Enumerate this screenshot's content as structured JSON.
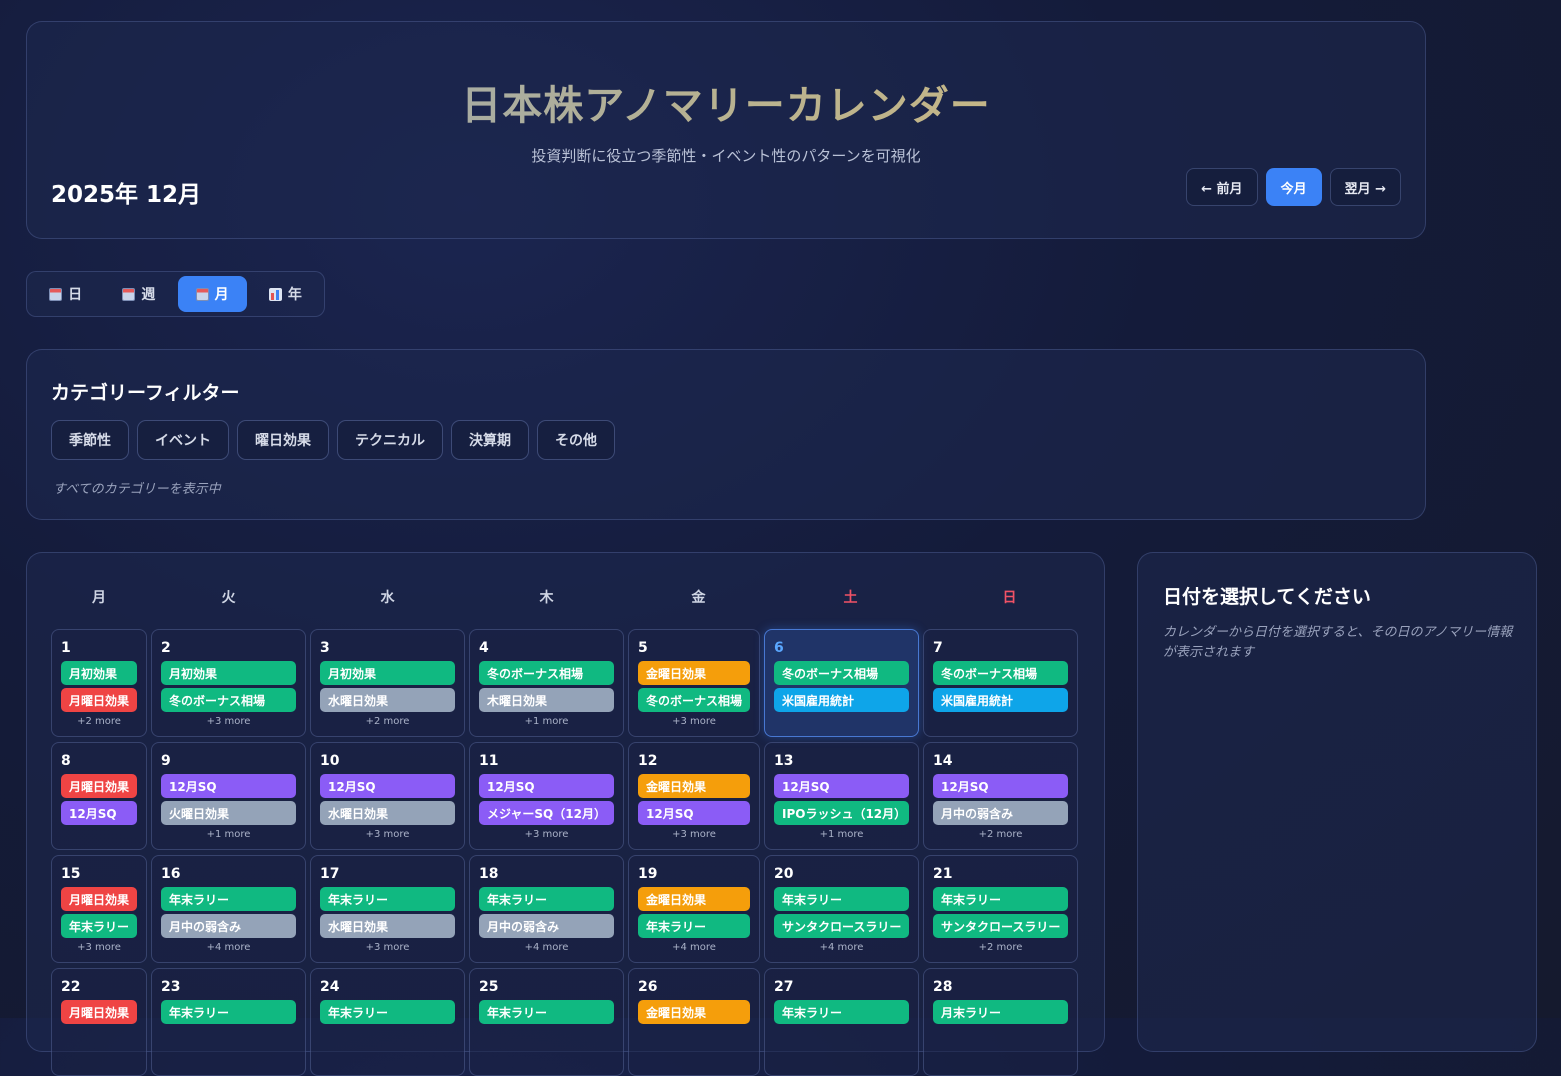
{
  "header": {
    "title": "日本株アノマリーカレンダー",
    "subtitle": "投資判断に役立つ季節性・イベント性のパターンを可視化",
    "month_label": "2025年 12月",
    "prev_label": "← 前月",
    "today_label": "今月",
    "next_label": "翌月 →"
  },
  "view_tabs": [
    {
      "label": "日",
      "icon": "calendar-icon"
    },
    {
      "label": "週",
      "icon": "calendar-icon"
    },
    {
      "label": "月",
      "icon": "calendar-icon",
      "active": true
    },
    {
      "label": "年",
      "icon": "bar-chart-icon"
    }
  ],
  "filter": {
    "title": "カテゴリーフィルター",
    "chips": [
      "季節性",
      "イベント",
      "曜日効果",
      "テクニカル",
      "決算期",
      "その他"
    ],
    "status": "すべてのカテゴリーを表示中"
  },
  "colors": {
    "green": "#10b981",
    "red": "#ef4444",
    "orange": "#f59e0b",
    "purple": "#8b5cf6",
    "gray": "#94a3b8",
    "blue": "#0ea5e9",
    "accent": "#3b82f6"
  },
  "calendar": {
    "weekdays": [
      "月",
      "火",
      "水",
      "木",
      "金",
      "土",
      "日"
    ],
    "days": [
      {
        "n": "1",
        "tags": [
          [
            "月初効果",
            "green"
          ],
          [
            "月曜日効果",
            "red"
          ]
        ],
        "more": "+2 more"
      },
      {
        "n": "2",
        "tags": [
          [
            "月初効果",
            "green"
          ],
          [
            "冬のボーナス相場",
            "green"
          ]
        ],
        "more": "+3 more"
      },
      {
        "n": "3",
        "tags": [
          [
            "月初効果",
            "green"
          ],
          [
            "水曜日効果",
            "gray"
          ]
        ],
        "more": "+2 more"
      },
      {
        "n": "4",
        "tags": [
          [
            "冬のボーナス相場",
            "green"
          ],
          [
            "木曜日効果",
            "gray"
          ]
        ],
        "more": "+1 more"
      },
      {
        "n": "5",
        "tags": [
          [
            "金曜日効果",
            "orange"
          ],
          [
            "冬のボーナス相場",
            "green"
          ]
        ],
        "more": "+3 more"
      },
      {
        "n": "6",
        "tags": [
          [
            "冬のボーナス相場",
            "green"
          ],
          [
            "米国雇用統計",
            "blue"
          ]
        ],
        "more": "",
        "today": true
      },
      {
        "n": "7",
        "tags": [
          [
            "冬のボーナス相場",
            "green"
          ],
          [
            "米国雇用統計",
            "blue"
          ]
        ],
        "more": ""
      },
      {
        "n": "8",
        "tags": [
          [
            "月曜日効果",
            "red"
          ],
          [
            "12月SQ",
            "purple"
          ]
        ],
        "more": ""
      },
      {
        "n": "9",
        "tags": [
          [
            "12月SQ",
            "purple"
          ],
          [
            "火曜日効果",
            "gray"
          ]
        ],
        "more": "+1 more"
      },
      {
        "n": "10",
        "tags": [
          [
            "12月SQ",
            "purple"
          ],
          [
            "水曜日効果",
            "gray"
          ]
        ],
        "more": "+3 more"
      },
      {
        "n": "11",
        "tags": [
          [
            "12月SQ",
            "purple"
          ],
          [
            "メジャーSQ（12月）",
            "purple"
          ]
        ],
        "more": "+3 more"
      },
      {
        "n": "12",
        "tags": [
          [
            "金曜日効果",
            "orange"
          ],
          [
            "12月SQ",
            "purple"
          ]
        ],
        "more": "+3 more"
      },
      {
        "n": "13",
        "tags": [
          [
            "12月SQ",
            "purple"
          ],
          [
            "IPOラッシュ（12月）",
            "green"
          ]
        ],
        "more": "+1 more"
      },
      {
        "n": "14",
        "tags": [
          [
            "12月SQ",
            "purple"
          ],
          [
            "月中の弱含み",
            "gray"
          ]
        ],
        "more": "+2 more"
      },
      {
        "n": "15",
        "tags": [
          [
            "月曜日効果",
            "red"
          ],
          [
            "年末ラリー",
            "green"
          ]
        ],
        "more": "+3 more"
      },
      {
        "n": "16",
        "tags": [
          [
            "年末ラリー",
            "green"
          ],
          [
            "月中の弱含み",
            "gray"
          ]
        ],
        "more": "+4 more"
      },
      {
        "n": "17",
        "tags": [
          [
            "年末ラリー",
            "green"
          ],
          [
            "水曜日効果",
            "gray"
          ]
        ],
        "more": "+3 more"
      },
      {
        "n": "18",
        "tags": [
          [
            "年末ラリー",
            "green"
          ],
          [
            "月中の弱含み",
            "gray"
          ]
        ],
        "more": "+4 more"
      },
      {
        "n": "19",
        "tags": [
          [
            "金曜日効果",
            "orange"
          ],
          [
            "年末ラリー",
            "green"
          ]
        ],
        "more": "+4 more"
      },
      {
        "n": "20",
        "tags": [
          [
            "年末ラリー",
            "green"
          ],
          [
            "サンタクロースラリー",
            "green"
          ]
        ],
        "more": "+4 more"
      },
      {
        "n": "21",
        "tags": [
          [
            "年末ラリー",
            "green"
          ],
          [
            "サンタクロースラリー",
            "green"
          ]
        ],
        "more": "+2 more"
      },
      {
        "n": "22",
        "tags": [
          [
            "月曜日効果",
            "red"
          ]
        ],
        "more": ""
      },
      {
        "n": "23",
        "tags": [
          [
            "年末ラリー",
            "green"
          ]
        ],
        "more": ""
      },
      {
        "n": "24",
        "tags": [
          [
            "年末ラリー",
            "green"
          ]
        ],
        "more": ""
      },
      {
        "n": "25",
        "tags": [
          [
            "年末ラリー",
            "green"
          ]
        ],
        "more": ""
      },
      {
        "n": "26",
        "tags": [
          [
            "金曜日効果",
            "orange"
          ]
        ],
        "more": ""
      },
      {
        "n": "27",
        "tags": [
          [
            "年末ラリー",
            "green"
          ]
        ],
        "more": ""
      },
      {
        "n": "28",
        "tags": [
          [
            "月末ラリー",
            "green"
          ]
        ],
        "more": ""
      }
    ]
  },
  "detail": {
    "title": "日付を選択してください",
    "message": "カレンダーから日付を選択すると、その日のアノマリー情報が表示されます"
  }
}
